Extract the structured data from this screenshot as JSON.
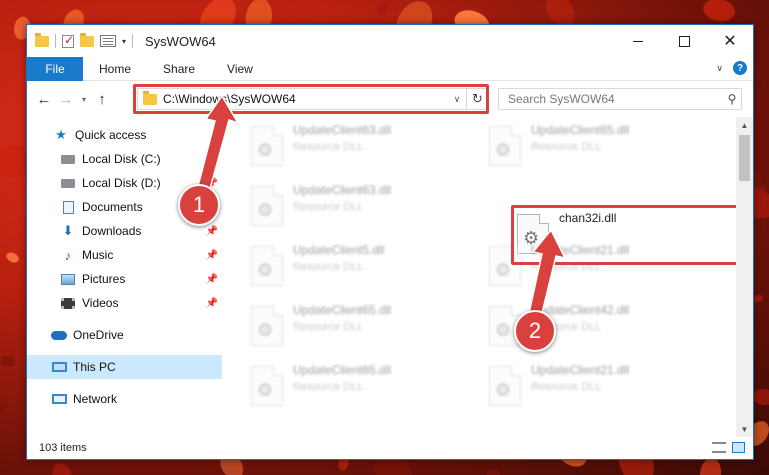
{
  "window": {
    "title": "SysWOW64",
    "minimize": "",
    "maximize": "",
    "close": "✕"
  },
  "ribbon": {
    "tabs": [
      "File",
      "Home",
      "Share",
      "View"
    ],
    "help": "?"
  },
  "nav": {
    "back": "←",
    "forward": "→",
    "recent": "▾",
    "up": "↑"
  },
  "address": {
    "path": "C:\\Windows\\SysWOW64",
    "refresh": "↻"
  },
  "search": {
    "placeholder": "Search SysWOW64"
  },
  "sidebar": {
    "items": [
      {
        "label": "Quick access"
      },
      {
        "label": "Local Disk (C:)"
      },
      {
        "label": "Local Disk (D:)"
      },
      {
        "label": "Documents"
      },
      {
        "label": "Downloads"
      },
      {
        "label": "Music"
      },
      {
        "label": "Pictures"
      },
      {
        "label": "Videos"
      },
      {
        "label": "OneDrive"
      },
      {
        "label": "This PC"
      },
      {
        "label": "Network"
      }
    ]
  },
  "files": [
    {
      "name": "UpdateClient63.dll",
      "type": "Resource DLL"
    },
    {
      "name": "UpdateClient65.dll",
      "type": "Resource DLL"
    },
    {
      "name": "UpdateClient63.dll",
      "type": "Resource DLL"
    },
    {
      "name": "chan32i.dll",
      "type": ""
    },
    {
      "name": "UpdateClient5.dll",
      "type": "Resource DLL"
    },
    {
      "name": "UpdateClient21.dll",
      "type": "Resource DLL"
    },
    {
      "name": "UpdateClient65.dll",
      "type": "Resource DLL"
    },
    {
      "name": "UpdateClient42.dll",
      "type": "Resource DLL"
    },
    {
      "name": "UpdateClient65.dll",
      "type": "Resource DLL"
    },
    {
      "name": "UpdateClient21.dll",
      "type": "Resource DLL"
    }
  ],
  "status": {
    "item_count": "103 items"
  },
  "annotations": {
    "step1": "1",
    "step2": "2",
    "color": "#d9413f"
  }
}
